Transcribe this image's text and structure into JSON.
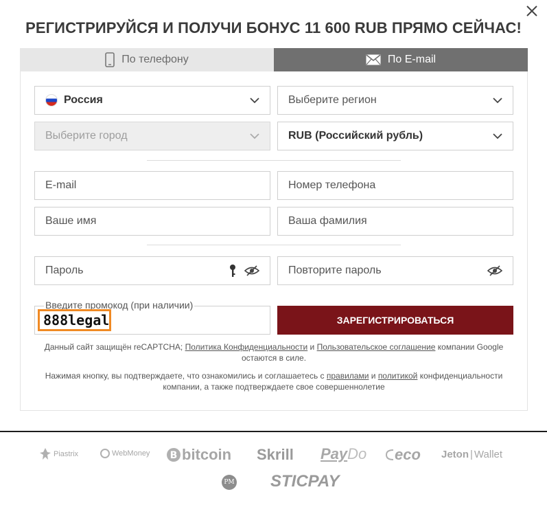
{
  "dialog": {
    "title": "РЕГИСТРИРУЙСЯ И ПОЛУЧИ БОНУС 11 600 RUB ПРЯМО СЕЙЧАС!",
    "close_icon": "close-icon"
  },
  "tabs": [
    {
      "label": "По телефону",
      "icon": "phone-icon",
      "active": false
    },
    {
      "label": "По E-mail",
      "icon": "envelope-icon",
      "active": true
    }
  ],
  "form": {
    "country": {
      "value": "Россия",
      "icon": "russia-flag-icon"
    },
    "region": {
      "placeholder": "Выберите регион"
    },
    "city": {
      "placeholder": "Выберите город",
      "disabled": true
    },
    "currency": {
      "value": "RUB (Российский рубль)"
    },
    "email": {
      "placeholder": "E-mail"
    },
    "phone": {
      "placeholder": "Номер телефона"
    },
    "first_name": {
      "placeholder": "Ваше имя"
    },
    "last_name": {
      "placeholder": "Ваша фамилия"
    },
    "password": {
      "placeholder": "Пароль"
    },
    "password_repeat": {
      "placeholder": "Повторите пароль"
    },
    "promo": {
      "label": "Введите промокод (при наличии)",
      "value": "888legal"
    },
    "register_button": "ЗАРЕГИСТРИРОВАТЬСЯ"
  },
  "notes": {
    "recaptcha_prefix": "Данный сайт защищён reCAPTCHA; ",
    "privacy_link": "Политика Конфиденциальности",
    "and": " и ",
    "terms_link": "Пользовательское соглашение",
    "recaptcha_suffix": " компании Google остаются в силе.",
    "agree_prefix": "Нажимая кнопку, вы подтверждаете, что ознакомились и соглашаетесь с ",
    "rules_link": "правилами",
    "agree_and": " и ",
    "policy_link": "политикой",
    "agree_suffix": " конфиденциальности компании, а также подтверждаете свое совершеннолетие"
  },
  "payments": {
    "piastrix": "Piastrix",
    "webmoney": "WebMoney",
    "bitcoin": "bitcoin",
    "skrill": "Skrill",
    "paydo_pay": "Pay",
    "paydo_do": "Do",
    "eco": "eco",
    "jeton_a": "Jeton",
    "jeton_b": "Wallet",
    "pm": "PM",
    "sticpay": "STICPAY"
  }
}
